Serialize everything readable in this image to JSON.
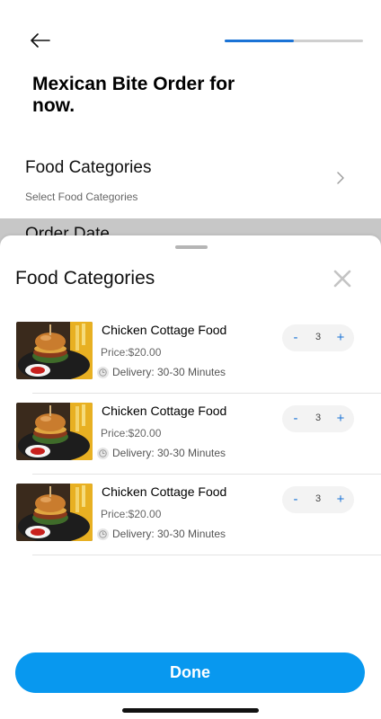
{
  "header": {
    "back_icon": "arrow-left-icon",
    "progress_fraction": 0.5,
    "title": "Mexican Bite Order for now."
  },
  "form": {
    "food_categories_label": "Food Categories",
    "food_categories_hint": "Select Food Categories",
    "order_date_label": "Order Date"
  },
  "sheet": {
    "title": "Food Categories",
    "close_icon": "close-icon",
    "items": [
      {
        "name": "Chicken Cottage Food",
        "price": "Price:$20.00",
        "delivery": "Delivery: 30-30 Minutes",
        "minus": "-",
        "quantity": "3",
        "plus": "+"
      },
      {
        "name": "Chicken Cottage Food",
        "price": "Price:$20.00",
        "delivery": "Delivery: 30-30 Minutes",
        "minus": "-",
        "quantity": "3",
        "plus": "+"
      },
      {
        "name": "Chicken Cottage Food",
        "price": "Price:$20.00",
        "delivery": "Delivery: 30-30 Minutes",
        "minus": "-",
        "quantity": "3",
        "plus": "+"
      }
    ],
    "done_label": "Done"
  },
  "colors": {
    "accent": "#1a73d6",
    "done_button": "#0898ef"
  }
}
